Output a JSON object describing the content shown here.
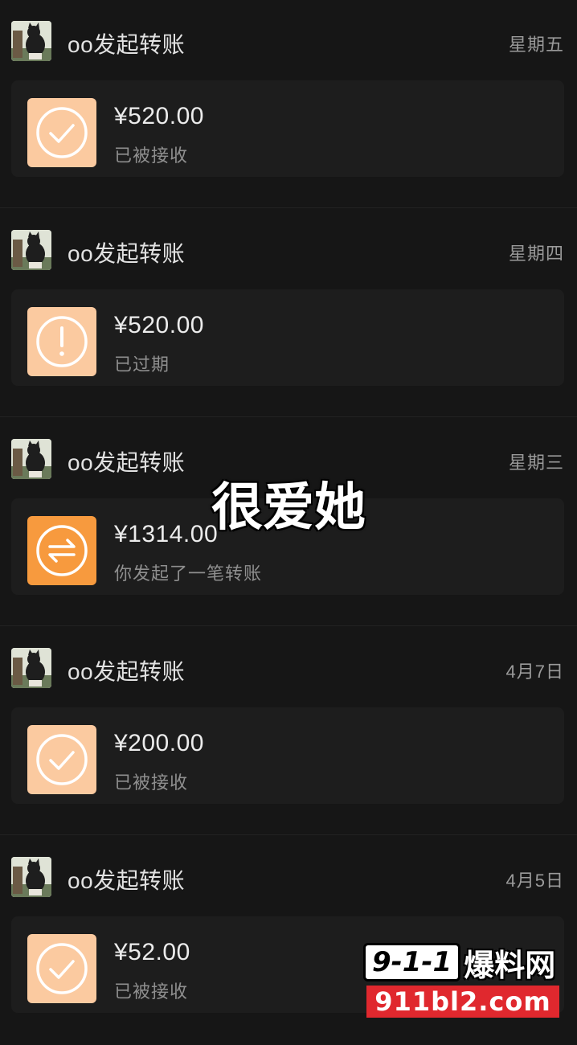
{
  "transfers": [
    {
      "sender": "oo发起转账",
      "time": "星期五",
      "amount": "¥520.00",
      "status": "已被接收",
      "icon": "check-icon",
      "accent": "#fbcaa0"
    },
    {
      "sender": "oo发起转账",
      "time": "星期四",
      "amount": "¥520.00",
      "status": "已过期",
      "icon": "exclamation-icon",
      "accent": "#fbcaa0"
    },
    {
      "sender": "oo发起转账",
      "time": "星期三",
      "amount": "¥1314.00",
      "status": "你发起了一笔转账",
      "icon": "transfer-arrows-icon",
      "accent": "#f79a3e"
    },
    {
      "sender": "oo发起转账",
      "time": "4月7日",
      "amount": "¥200.00",
      "status": "已被接收",
      "icon": "check-icon",
      "accent": "#fbcaa0"
    },
    {
      "sender": "oo发起转账",
      "time": "4月5日",
      "amount": "¥52.00",
      "status": "已被接收",
      "icon": "check-icon",
      "accent": "#fbcaa0"
    }
  ],
  "overlay": {
    "caption": "很爱她"
  },
  "watermark": {
    "logo": "9-1-1",
    "brand": "爆料网",
    "url": "911bl2.com"
  }
}
